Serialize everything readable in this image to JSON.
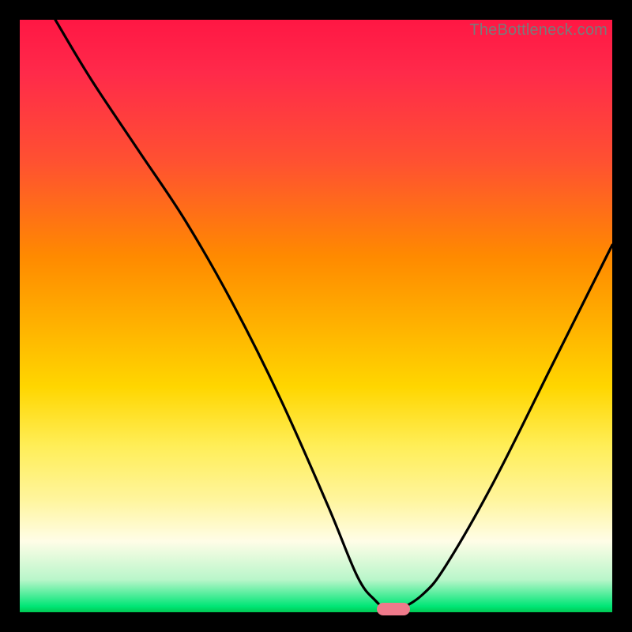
{
  "watermark": "TheBottleneck.com",
  "colors": {
    "frame": "#000000",
    "curve": "#000000",
    "marker": "#ef7a8b",
    "gradient_top": "#ff1744",
    "gradient_bottom": "#00c853"
  },
  "chart_data": {
    "type": "line",
    "title": "",
    "xlabel": "",
    "ylabel": "",
    "xlim": [
      0,
      100
    ],
    "ylim": [
      0,
      100
    ],
    "grid": false,
    "series": [
      {
        "name": "bottleneck-curve",
        "x": [
          6,
          12,
          20,
          28,
          36,
          44,
          52,
          57,
          60,
          62,
          64,
          68,
          72,
          80,
          90,
          100
        ],
        "y": [
          100,
          90,
          78,
          66,
          52,
          36,
          18,
          6,
          2,
          0.5,
          0.5,
          3,
          8,
          22,
          42,
          62
        ]
      }
    ],
    "annotations": [
      {
        "name": "optimal-marker",
        "x": 63,
        "y": 0.5
      }
    ]
  }
}
